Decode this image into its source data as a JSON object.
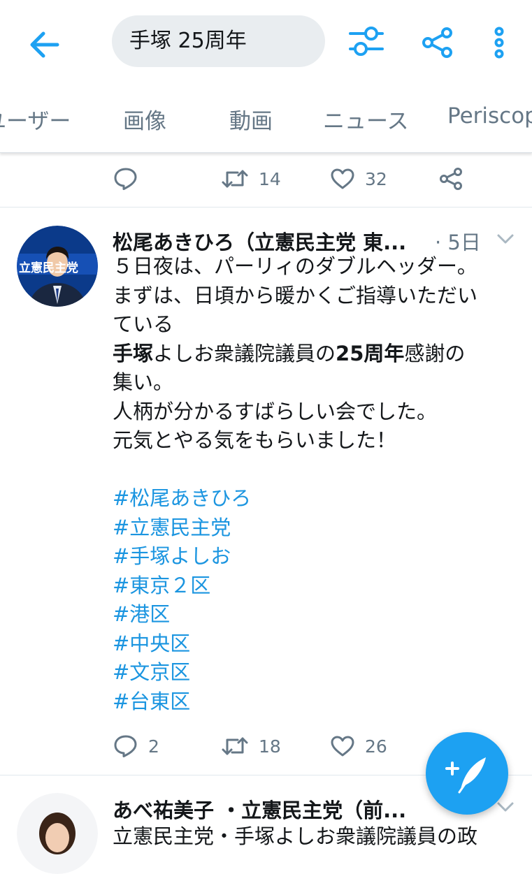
{
  "search": {
    "query": "手塚 25周年"
  },
  "tabs": [
    {
      "label": "ユーザー"
    },
    {
      "label": "画像"
    },
    {
      "label": "動画"
    },
    {
      "label": "ニュース"
    },
    {
      "label": "Periscope"
    }
  ],
  "prev_tweet": {
    "retweets": "14",
    "likes": "32"
  },
  "tweet": {
    "author": "松尾あきひろ（立憲民主党 東...",
    "time": "· 5日",
    "avatar_text": "立憲民主党",
    "lines": [
      "５日夜は、パーリィのダブルヘッダー。",
      "まずは、日頃から暖かくご指導いただい",
      "ている"
    ],
    "line4": {
      "b1": "手塚",
      "t1": "よしお衆議院議員の",
      "b2": "25周年",
      "t2": "感謝の"
    },
    "lines_after": [
      "集い。",
      "人柄が分かるすばらしい会でした。",
      "元気とやる気をもらいました！"
    ],
    "hashtags": [
      "#松尾あきひろ",
      "#立憲民主党",
      "#手塚よしお",
      "#東京２区",
      "#港区",
      "#中央区",
      "#文京区",
      "#台東区"
    ],
    "replies": "2",
    "retweets": "18",
    "likes": "26"
  },
  "next_tweet": {
    "author": "あべ祐美子 ・立憲民主党（前...",
    "text": "立憲民主党・手塚よしお衆議院議員の政"
  },
  "colors": {
    "accent": "#1da1f2",
    "hashtag": "#1b95e0",
    "muted": "#657786"
  },
  "icons": [
    "back-arrow-icon",
    "filter-icon",
    "share-icon",
    "more-vertical-icon",
    "reply-icon",
    "retweet-icon",
    "heart-icon",
    "compose-icon",
    "chevron-down-icon"
  ]
}
